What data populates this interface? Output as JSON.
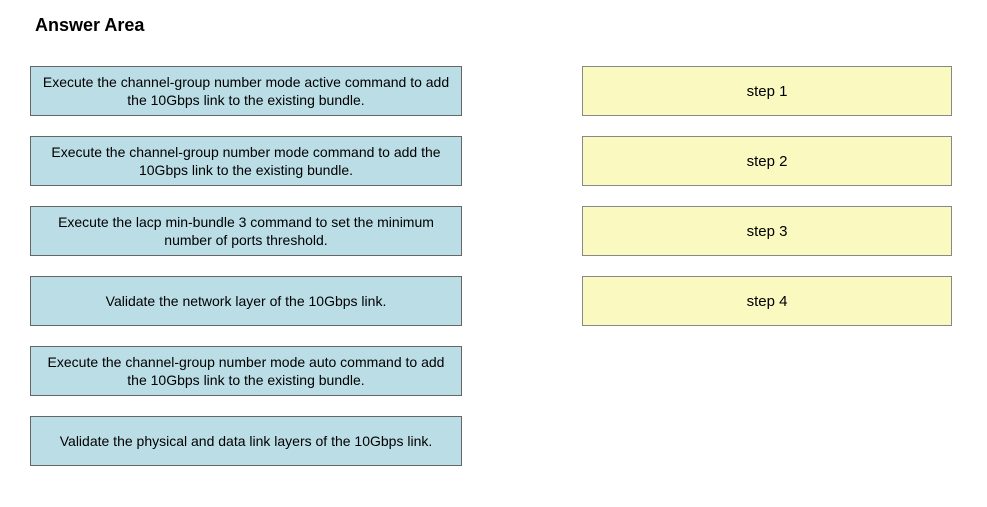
{
  "title": "Answer Area",
  "sourceItems": [
    "Execute the channel-group number mode active command to add the 10Gbps link to the existing bundle.",
    "Execute the channel-group number mode command to add the 10Gbps link to the existing bundle.",
    "Execute the lacp min-bundle 3 command to set the minimum number of ports threshold.",
    "Validate the network layer of the 10Gbps link.",
    "Execute the channel-group number mode auto command to add the 10Gbps link to the existing bundle.",
    "Validate the physical and data link layers of the 10Gbps link."
  ],
  "targetItems": [
    "step 1",
    "step 2",
    "step 3",
    "step 4"
  ]
}
